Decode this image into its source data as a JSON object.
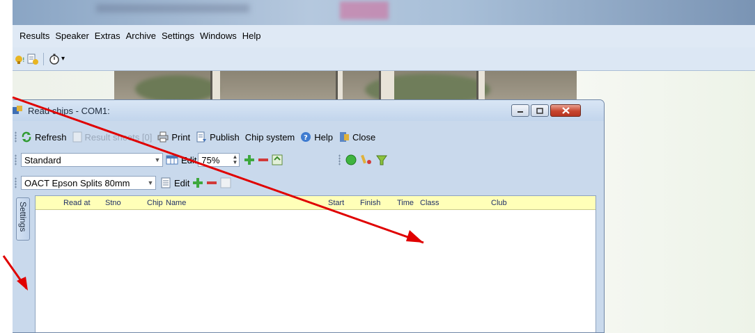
{
  "menu": [
    "Results",
    "Speaker",
    "Extras",
    "Archive",
    "Settings",
    "Windows",
    "Help"
  ],
  "app_toolbar": {
    "icons": [
      "trophy-results-icon",
      "document-results-icon",
      "stopwatch-icon"
    ],
    "dropdown_indicator": "▾"
  },
  "chip_window": {
    "title": "Read chips - COM1:",
    "toolbar1": {
      "refresh": "Refresh",
      "result_sheets": "Result sheets [0]",
      "print": "Print",
      "publish": "Publish",
      "chip_system": "Chip system",
      "help": "Help",
      "close": "Close"
    },
    "toolbar2": {
      "layout_value": "Standard",
      "edit": "Edit",
      "zoom": "75%"
    },
    "toolbar3": {
      "chip_value": "OACT Epson Splits 80mm",
      "edit": "Edit"
    },
    "settings_tab": "Settings",
    "grid_columns": [
      "Read at",
      "Stno",
      "Chip",
      "Name",
      "Start",
      "Finish",
      "Time",
      "Class",
      "Club"
    ]
  },
  "colors": {
    "annotation_arrow": "#e00000",
    "grid_header": "#ffffb8",
    "window_frame": "#c9d9ec"
  }
}
